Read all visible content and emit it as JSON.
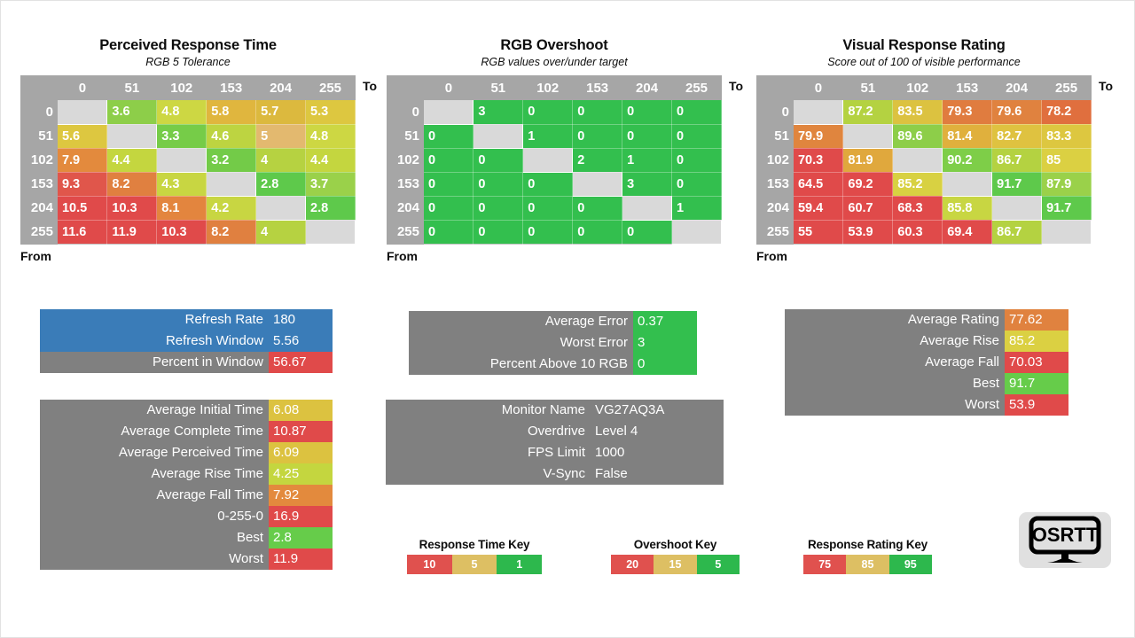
{
  "colors": {
    "header_gray": "#a6a6a6",
    "diagonal_gray": "#d9d9d9",
    "box_gray": "#808080",
    "blue": "#3a7cb8",
    "red": "#e04a4a",
    "orange": "#e38a3d",
    "yellow": "#dcc241",
    "yellow_green": "#c4d63f",
    "green": "#7ece48",
    "bright_green": "#33bf4e",
    "key_red": "#e0514e",
    "key_tan": "#ddbf63",
    "key_green": "#2db84d"
  },
  "panels": [
    {
      "title": "Perceived Response Time",
      "subtitle": "RGB 5 Tolerance",
      "to_label": "To",
      "from_label": "From",
      "columns": [
        "0",
        "51",
        "102",
        "153",
        "204",
        "255"
      ],
      "rows": [
        "0",
        "51",
        "102",
        "153",
        "204",
        "255"
      ],
      "matrix": [
        [
          "",
          "3.6",
          "4.8",
          "5.8",
          "5.7",
          "5.3"
        ],
        [
          "5.6",
          "",
          "3.3",
          "4.6",
          "5",
          "4.8"
        ],
        [
          "7.9",
          "4.4",
          "",
          "3.2",
          "4",
          "4.4"
        ],
        [
          "9.3",
          "8.2",
          "4.3",
          "",
          "2.8",
          "3.7"
        ],
        [
          "10.5",
          "10.3",
          "8.1",
          "4.2",
          "",
          "2.8"
        ],
        [
          "11.6",
          "11.9",
          "10.3",
          "8.2",
          "4",
          ""
        ]
      ],
      "cell_colors": [
        [
          "#d9d9d9",
          "#8dce49",
          "#cdd743",
          "#e0b63e",
          "#dcb93e",
          "#ddc740"
        ],
        [
          "#ddc740",
          "#d9d9d9",
          "#76cc48",
          "#bdd441",
          "#e3b96f",
          "#cdd743"
        ],
        [
          "#e38a3d",
          "#c4d63f",
          "#d9d9d9",
          "#73cb48",
          "#b6d241",
          "#c4d63f"
        ],
        [
          "#e0564b",
          "#e08040",
          "#c8d642",
          "#d9d9d9",
          "#5ec94b",
          "#9ad14a"
        ],
        [
          "#e04a4a",
          "#e04a4a",
          "#e3853e",
          "#c8d642",
          "#d9d9d9",
          "#5ec94b"
        ],
        [
          "#e04a4a",
          "#e04a4a",
          "#e04a4a",
          "#e08040",
          "#b6d241",
          "#d9d9d9"
        ]
      ]
    },
    {
      "title": "RGB Overshoot",
      "subtitle": "RGB values over/under target",
      "to_label": "To",
      "from_label": "From",
      "columns": [
        "0",
        "51",
        "102",
        "153",
        "204",
        "255"
      ],
      "rows": [
        "0",
        "51",
        "102",
        "153",
        "204",
        "255"
      ],
      "matrix": [
        [
          "",
          "3",
          "0",
          "0",
          "0",
          "0"
        ],
        [
          "0",
          "",
          "1",
          "0",
          "0",
          "0"
        ],
        [
          "0",
          "0",
          "",
          "2",
          "1",
          "0"
        ],
        [
          "0",
          "0",
          "0",
          "",
          "3",
          "0"
        ],
        [
          "0",
          "0",
          "0",
          "0",
          "",
          "1"
        ],
        [
          "0",
          "0",
          "0",
          "0",
          "0",
          ""
        ]
      ],
      "cell_colors": [
        [
          "#d9d9d9",
          "#33bf4e",
          "#33bf4e",
          "#33bf4e",
          "#33bf4e",
          "#33bf4e"
        ],
        [
          "#33bf4e",
          "#d9d9d9",
          "#33bf4e",
          "#33bf4e",
          "#33bf4e",
          "#33bf4e"
        ],
        [
          "#33bf4e",
          "#33bf4e",
          "#d9d9d9",
          "#33bf4e",
          "#33bf4e",
          "#33bf4e"
        ],
        [
          "#33bf4e",
          "#33bf4e",
          "#33bf4e",
          "#d9d9d9",
          "#33bf4e",
          "#33bf4e"
        ],
        [
          "#33bf4e",
          "#33bf4e",
          "#33bf4e",
          "#33bf4e",
          "#d9d9d9",
          "#33bf4e"
        ],
        [
          "#33bf4e",
          "#33bf4e",
          "#33bf4e",
          "#33bf4e",
          "#33bf4e",
          "#d9d9d9"
        ]
      ]
    },
    {
      "title": "Visual Response Rating",
      "subtitle": "Score out of 100 of visible performance",
      "to_label": "To",
      "from_label": "From",
      "columns": [
        "0",
        "51",
        "102",
        "153",
        "204",
        "255"
      ],
      "rows": [
        "0",
        "51",
        "102",
        "153",
        "204",
        "255"
      ],
      "matrix": [
        [
          "",
          "87.2",
          "83.5",
          "79.3",
          "79.6",
          "78.2"
        ],
        [
          "79.9",
          "",
          "89.6",
          "81.4",
          "82.7",
          "83.3"
        ],
        [
          "70.3",
          "81.9",
          "",
          "90.2",
          "86.7",
          "85"
        ],
        [
          "64.5",
          "69.2",
          "85.2",
          "",
          "91.7",
          "87.9"
        ],
        [
          "59.4",
          "60.7",
          "68.3",
          "85.8",
          "",
          "91.7"
        ],
        [
          "55",
          "53.9",
          "60.3",
          "69.4",
          "86.7",
          ""
        ]
      ],
      "cell_colors": [
        [
          "#d9d9d9",
          "#b4d241",
          "#dcc240",
          "#e07c3f",
          "#e0823f",
          "#e06f3e"
        ],
        [
          "#e0853e",
          "#d9d9d9",
          "#8dce49",
          "#e0b03d",
          "#dfc240",
          "#ddc740"
        ],
        [
          "#e04a4a",
          "#e0a83d",
          "#d9d9d9",
          "#7ece48",
          "#b4d241",
          "#dbd042"
        ],
        [
          "#e04a4a",
          "#e04a4a",
          "#d8d142",
          "#d9d9d9",
          "#5ec94b",
          "#9ad14a"
        ],
        [
          "#e04a4a",
          "#e04a4a",
          "#e04a4a",
          "#c8d642",
          "#d9d9d9",
          "#5ec94b"
        ],
        [
          "#e04a4a",
          "#e04a4a",
          "#e04a4a",
          "#e04a4a",
          "#b4d241",
          "#d9d9d9"
        ]
      ]
    }
  ],
  "summary_refresh": {
    "rows": [
      {
        "label": "Refresh Rate",
        "value": "180",
        "row_bg": "#3a7cb8",
        "value_bg": "#3a7cb8"
      },
      {
        "label": "Refresh Window",
        "value": "5.56",
        "row_bg": "#3a7cb8",
        "value_bg": "#3a7cb8"
      },
      {
        "label": "Percent in Window",
        "value": "56.67",
        "row_bg": "#808080",
        "value_bg": "#e04a4a"
      }
    ]
  },
  "summary_times": {
    "rows": [
      {
        "label": "Average Initial Time",
        "value": "6.08",
        "value_bg": "#dcc240"
      },
      {
        "label": "Average Complete Time",
        "value": "10.87",
        "value_bg": "#e04a4a"
      },
      {
        "label": "Average Perceived Time",
        "value": "6.09",
        "value_bg": "#dcc240"
      },
      {
        "label": "Average Rise Time",
        "value": "4.25",
        "value_bg": "#c4d63f"
      },
      {
        "label": "Average Fall Time",
        "value": "7.92",
        "value_bg": "#e38a3d"
      },
      {
        "label": "0-255-0",
        "value": "16.9",
        "value_bg": "#e04a4a"
      },
      {
        "label": "Best",
        "value": "2.8",
        "value_bg": "#66cc4a"
      },
      {
        "label": "Worst",
        "value": "11.9",
        "value_bg": "#e04a4a"
      }
    ]
  },
  "summary_overshoot": {
    "rows": [
      {
        "label": "Average Error",
        "value": "0.37",
        "value_bg": "#33bf4e"
      },
      {
        "label": "Worst Error",
        "value": "3",
        "value_bg": "#33bf4e"
      },
      {
        "label": "Percent Above 10 RGB",
        "value": "0",
        "value_bg": "#33bf4e"
      }
    ]
  },
  "summary_monitor": {
    "rows": [
      {
        "label": "Monitor Name",
        "value": "VG27AQ3A",
        "value_bg": "#808080"
      },
      {
        "label": "Overdrive",
        "value": "Level 4",
        "value_bg": "#808080"
      },
      {
        "label": "FPS Limit",
        "value": "1000",
        "value_bg": "#808080"
      },
      {
        "label": "V-Sync",
        "value": "False",
        "value_bg": "#808080"
      }
    ]
  },
  "summary_rating": {
    "rows": [
      {
        "label": "Average Rating",
        "value": "77.62",
        "value_bg": "#e0823f"
      },
      {
        "label": "Average Rise",
        "value": "85.2",
        "value_bg": "#dbd042"
      },
      {
        "label": "Average Fall",
        "value": "70.03",
        "value_bg": "#e04a4a"
      },
      {
        "label": "Best",
        "value": "91.7",
        "value_bg": "#66cc4a"
      },
      {
        "label": "Worst",
        "value": "53.9",
        "value_bg": "#e04a4a"
      }
    ]
  },
  "keys": [
    {
      "title": "Response Time Key",
      "swatches": [
        {
          "label": "10",
          "color": "#e0514e"
        },
        {
          "label": "5",
          "color": "#ddbf63"
        },
        {
          "label": "1",
          "color": "#2db84d"
        }
      ]
    },
    {
      "title": "Overshoot Key",
      "swatches": [
        {
          "label": "20",
          "color": "#e0514e"
        },
        {
          "label": "15",
          "color": "#ddbf63"
        },
        {
          "label": "5",
          "color": "#2db84d"
        }
      ]
    },
    {
      "title": "Response Rating Key",
      "swatches": [
        {
          "label": "75",
          "color": "#e0514e"
        },
        {
          "label": "85",
          "color": "#ddbf63"
        },
        {
          "label": "95",
          "color": "#2db84d"
        }
      ]
    }
  ],
  "logo": {
    "text": "OSRTT"
  },
  "chart_data": [
    {
      "type": "heatmap",
      "title": "Perceived Response Time",
      "subtitle": "RGB 5 Tolerance",
      "xlabel": "To",
      "ylabel": "From",
      "categories_x": [
        0,
        51,
        102,
        153,
        204,
        255
      ],
      "categories_y": [
        0,
        51,
        102,
        153,
        204,
        255
      ],
      "values": [
        [
          null,
          3.6,
          4.8,
          5.8,
          5.7,
          5.3
        ],
        [
          5.6,
          null,
          3.3,
          4.6,
          5,
          4.8
        ],
        [
          7.9,
          4.4,
          null,
          3.2,
          4,
          4.4
        ],
        [
          9.3,
          8.2,
          4.3,
          null,
          2.8,
          3.7
        ],
        [
          10.5,
          10.3,
          8.1,
          4.2,
          null,
          2.8
        ],
        [
          11.6,
          11.9,
          10.3,
          8.2,
          4,
          null
        ]
      ],
      "scale": {
        "low": 1,
        "mid": 5,
        "high": 10,
        "unit": "ms"
      }
    },
    {
      "type": "heatmap",
      "title": "RGB Overshoot",
      "subtitle": "RGB values over/under target",
      "xlabel": "To",
      "ylabel": "From",
      "categories_x": [
        0,
        51,
        102,
        153,
        204,
        255
      ],
      "categories_y": [
        0,
        51,
        102,
        153,
        204,
        255
      ],
      "values": [
        [
          null,
          3,
          0,
          0,
          0,
          0
        ],
        [
          0,
          null,
          1,
          0,
          0,
          0
        ],
        [
          0,
          0,
          null,
          2,
          1,
          0
        ],
        [
          0,
          0,
          0,
          null,
          3,
          0
        ],
        [
          0,
          0,
          0,
          0,
          null,
          1
        ],
        [
          0,
          0,
          0,
          0,
          0,
          null
        ]
      ],
      "scale": {
        "low": 5,
        "mid": 15,
        "high": 20,
        "unit": "RGB"
      }
    },
    {
      "type": "heatmap",
      "title": "Visual Response Rating",
      "subtitle": "Score out of 100 of visible performance",
      "xlabel": "To",
      "ylabel": "From",
      "categories_x": [
        0,
        51,
        102,
        153,
        204,
        255
      ],
      "categories_y": [
        0,
        51,
        102,
        153,
        204,
        255
      ],
      "values": [
        [
          null,
          87.2,
          83.5,
          79.3,
          79.6,
          78.2
        ],
        [
          79.9,
          null,
          89.6,
          81.4,
          82.7,
          83.3
        ],
        [
          70.3,
          81.9,
          null,
          90.2,
          86.7,
          85
        ],
        [
          64.5,
          69.2,
          85.2,
          null,
          91.7,
          87.9
        ],
        [
          59.4,
          60.7,
          68.3,
          85.8,
          null,
          91.7
        ],
        [
          55,
          53.9,
          60.3,
          69.4,
          86.7,
          null
        ]
      ],
      "scale": {
        "low": 75,
        "mid": 85,
        "high": 95,
        "unit": "score"
      }
    }
  ]
}
